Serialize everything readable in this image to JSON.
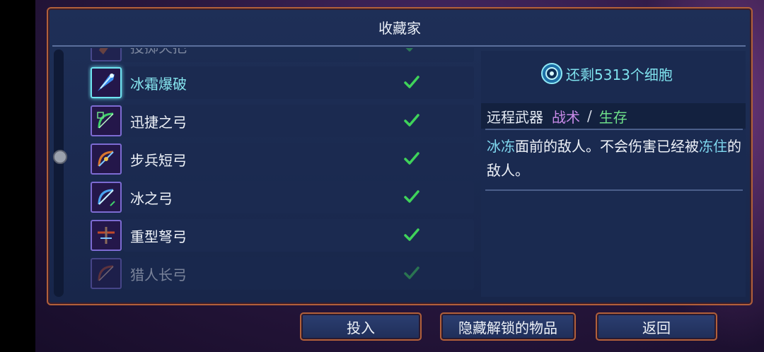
{
  "title": "收藏家",
  "cells_text": "还剩5313个细胞",
  "items": [
    {
      "name": "投掷火把",
      "checked": true,
      "faded": true,
      "selected": false,
      "icon": "torch-icon"
    },
    {
      "name": "冰霜爆破",
      "checked": true,
      "faded": false,
      "selected": true,
      "icon": "frost-blast-icon"
    },
    {
      "name": "迅捷之弓",
      "checked": true,
      "faded": false,
      "selected": false,
      "icon": "quick-bow-icon"
    },
    {
      "name": "步兵短弓",
      "checked": true,
      "faded": false,
      "selected": false,
      "icon": "infantry-bow-icon"
    },
    {
      "name": "冰之弓",
      "checked": true,
      "faded": false,
      "selected": false,
      "icon": "ice-bow-icon"
    },
    {
      "name": "重型弩弓",
      "checked": true,
      "faded": false,
      "selected": false,
      "icon": "heavy-crossbow-icon"
    },
    {
      "name": "猎人长弓",
      "checked": true,
      "faded": true,
      "selected": false,
      "icon": "hunter-longbow-icon"
    }
  ],
  "detail": {
    "category": "远程武器",
    "tag_tactic": "战术",
    "separator": "/",
    "tag_survival": "生存",
    "desc_hl1": "冰冻",
    "desc_part1": "面前的敌人。不会伤害已经被",
    "desc_hl2": "冻住",
    "desc_part2": "的敌人。"
  },
  "buttons": {
    "invest": "投入",
    "hide_unlocked": "隐藏解锁的物品",
    "back": "返回"
  },
  "colors": {
    "accent_cyan": "#7fe2ee",
    "tactic_purple": "#c88ae8",
    "survival_green": "#6ee08a",
    "frame_orange": "#b2603a",
    "check_green": "#3fd35a"
  }
}
